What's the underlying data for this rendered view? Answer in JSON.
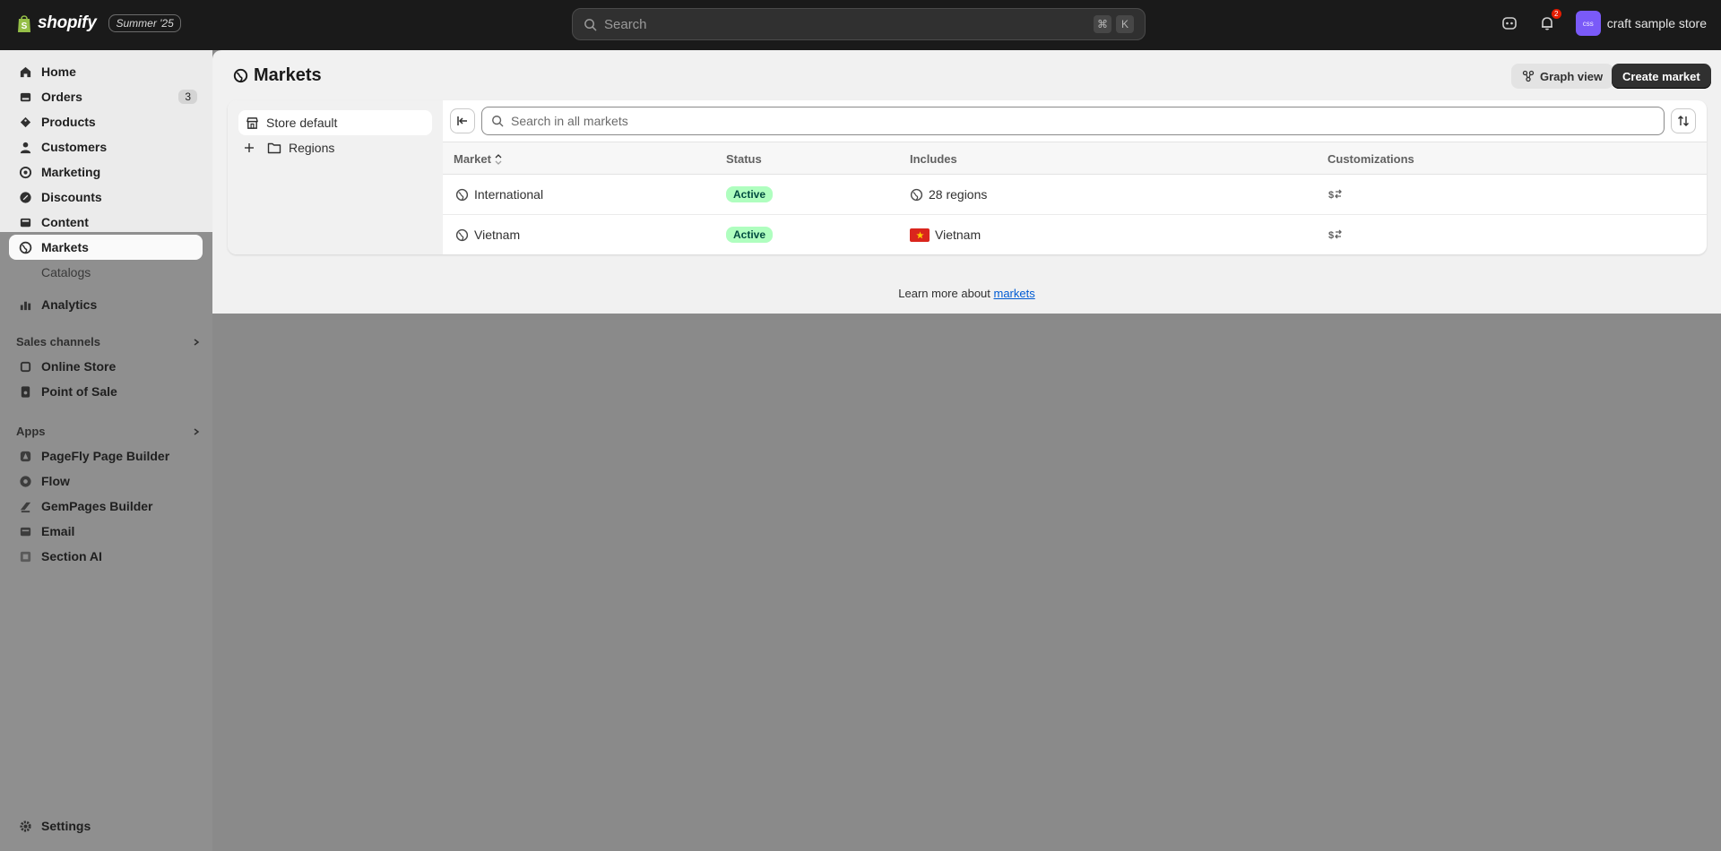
{
  "topbar": {
    "brand": "shopify",
    "edition": "Summer '25",
    "search_placeholder": "Search",
    "kbd_cmd": "⌘",
    "kbd_k": "K",
    "notification_count": "2",
    "store_initials": "css",
    "store_name": "craft sample store"
  },
  "sidebar": {
    "items": [
      {
        "label": "Home",
        "icon": "home-icon"
      },
      {
        "label": "Orders",
        "icon": "orders-icon",
        "badge": "3"
      },
      {
        "label": "Products",
        "icon": "products-icon"
      },
      {
        "label": "Customers",
        "icon": "customers-icon"
      },
      {
        "label": "Marketing",
        "icon": "marketing-icon"
      },
      {
        "label": "Discounts",
        "icon": "discounts-icon"
      },
      {
        "label": "Content",
        "icon": "content-icon"
      },
      {
        "label": "Markets",
        "icon": "globe-icon",
        "active": true
      },
      {
        "label": "Catalogs",
        "sub": true
      },
      {
        "label": "Analytics",
        "icon": "analytics-icon"
      }
    ],
    "sales_channels_label": "Sales channels",
    "sales_channels": [
      {
        "label": "Online Store",
        "icon": "online-store-icon"
      },
      {
        "label": "Point of Sale",
        "icon": "pos-icon"
      }
    ],
    "apps_label": "Apps",
    "apps": [
      {
        "label": "PageFly Page Builder",
        "icon": "pagefly-icon"
      },
      {
        "label": "Flow",
        "icon": "flow-icon"
      },
      {
        "label": "GemPages Builder",
        "icon": "gempages-icon"
      },
      {
        "label": "Email",
        "icon": "email-icon"
      },
      {
        "label": "Section AI",
        "icon": "section-ai-icon"
      }
    ],
    "settings_label": "Settings"
  },
  "main": {
    "title": "Markets",
    "graph_view_label": "Graph view",
    "create_market_label": "Create market",
    "tree": {
      "store_default": "Store default",
      "regions": "Regions"
    },
    "search_placeholder": "Search in all markets",
    "columns": [
      "Market",
      "Status",
      "Includes",
      "Customizations"
    ],
    "rows": [
      {
        "market": "International",
        "status": "Active",
        "includes": "28 regions",
        "includes_icon": "globe-icon",
        "customizations_icon": "currency-exchange-icon"
      },
      {
        "market": "Vietnam",
        "status": "Active",
        "includes": "Vietnam",
        "includes_icon": "vietnam-flag-icon",
        "customizations_icon": "currency-exchange-icon"
      }
    ],
    "footer_prefix": "Learn more about ",
    "footer_link": "markets"
  },
  "colors": {
    "topbar_bg": "#1a1a1a",
    "active_badge_bg": "#affebf",
    "primary_button": "#303030",
    "link": "#005bd3"
  }
}
